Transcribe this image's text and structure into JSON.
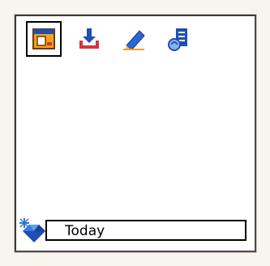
{
  "toolbar": {
    "items": [
      {
        "icon": "calendar-view-icon",
        "selected": true
      },
      {
        "icon": "download-icon",
        "selected": false
      },
      {
        "icon": "edit-pencil-icon",
        "selected": false
      },
      {
        "icon": "document-sync-icon",
        "selected": false
      }
    ]
  },
  "status": {
    "today_label": "Today",
    "icon": "today-gem-icon"
  },
  "colors": {
    "accent_orange": "#f7a21b",
    "accent_blue": "#1f4fb3",
    "accent_red": "#d6323a",
    "frame_border": "#3a3a3a"
  }
}
